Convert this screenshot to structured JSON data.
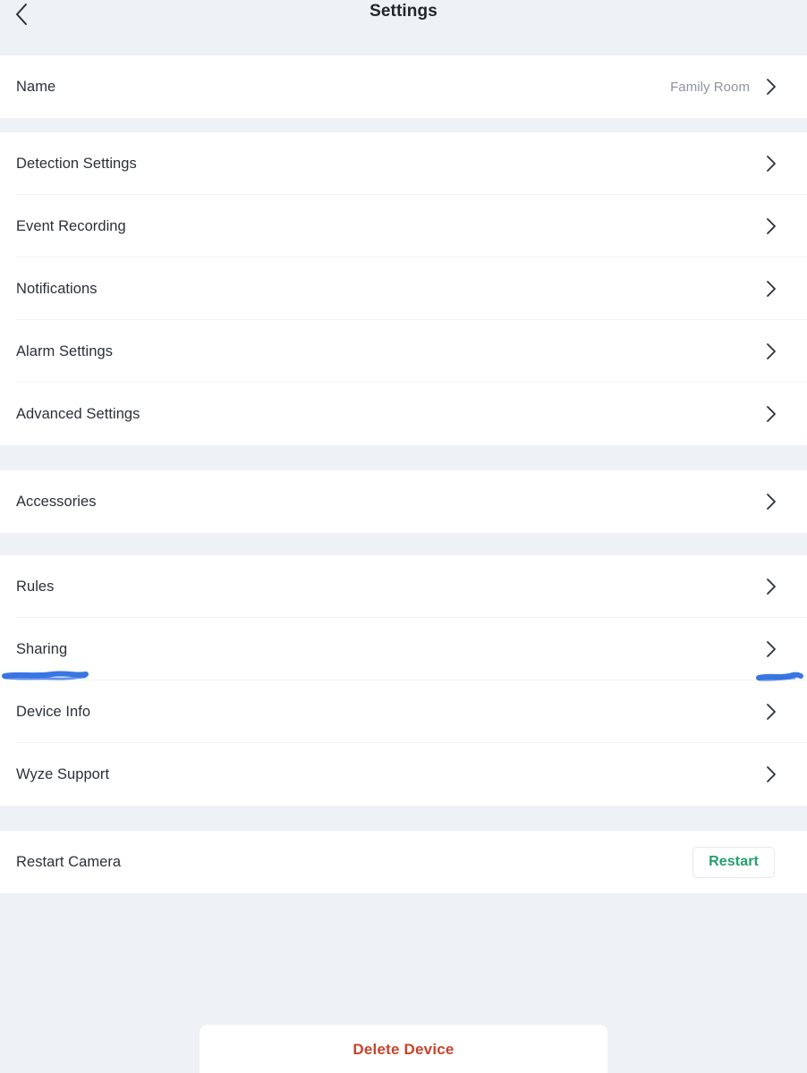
{
  "header": {
    "title": "Settings",
    "back_icon": "chevron-left-icon"
  },
  "colors": {
    "background": "#eef1f5",
    "surface": "#ffffff",
    "primary_text": "#2b3038",
    "secondary_text": "#8e949d",
    "restart_green": "#22a06b",
    "delete_red": "#c8432a",
    "annotation_blue": "#2f6fe0",
    "separator": "#f2f3f5"
  },
  "sections": [
    {
      "id": "name-section",
      "rows": [
        {
          "name": "name",
          "label": "Name",
          "value": "Family Room",
          "chevron": "chevron-right-icon"
        }
      ]
    },
    {
      "id": "camera-settings-section",
      "rows": [
        {
          "name": "detection-settings",
          "label": "Detection Settings",
          "chevron": "chevron-right-icon"
        },
        {
          "name": "event-recording",
          "label": "Event Recording",
          "chevron": "chevron-right-icon"
        },
        {
          "name": "notifications",
          "label": "Notifications",
          "chevron": "chevron-right-icon"
        },
        {
          "name": "alarm-settings",
          "label": "Alarm Settings",
          "chevron": "chevron-right-icon"
        },
        {
          "name": "advanced-settings",
          "label": "Advanced Settings",
          "chevron": "chevron-right-icon"
        }
      ]
    },
    {
      "id": "accessories-section",
      "rows": [
        {
          "name": "accessories",
          "label": "Accessories",
          "chevron": "chevron-right-icon"
        }
      ]
    },
    {
      "id": "management-section",
      "rows": [
        {
          "name": "rules",
          "label": "Rules",
          "chevron": "chevron-right-icon"
        },
        {
          "name": "sharing",
          "label": "Sharing",
          "chevron": "chevron-right-icon"
        },
        {
          "name": "device-info",
          "label": "Device Info",
          "chevron": "chevron-right-icon"
        },
        {
          "name": "wyze-support",
          "label": "Wyze Support",
          "chevron": "chevron-right-icon"
        }
      ]
    },
    {
      "id": "restart-section",
      "rows": [
        {
          "name": "restart-camera",
          "label": "Restart Camera",
          "button_label": "Restart"
        }
      ]
    }
  ],
  "delete": {
    "label": "Delete Device"
  },
  "annotations": [
    {
      "name": "sharing-label-underline",
      "target": "Sharing",
      "color": "#2f6fe0"
    },
    {
      "name": "sharing-chevron-underline",
      "target": "chevron-right-icon",
      "color": "#2f6fe0"
    }
  ]
}
